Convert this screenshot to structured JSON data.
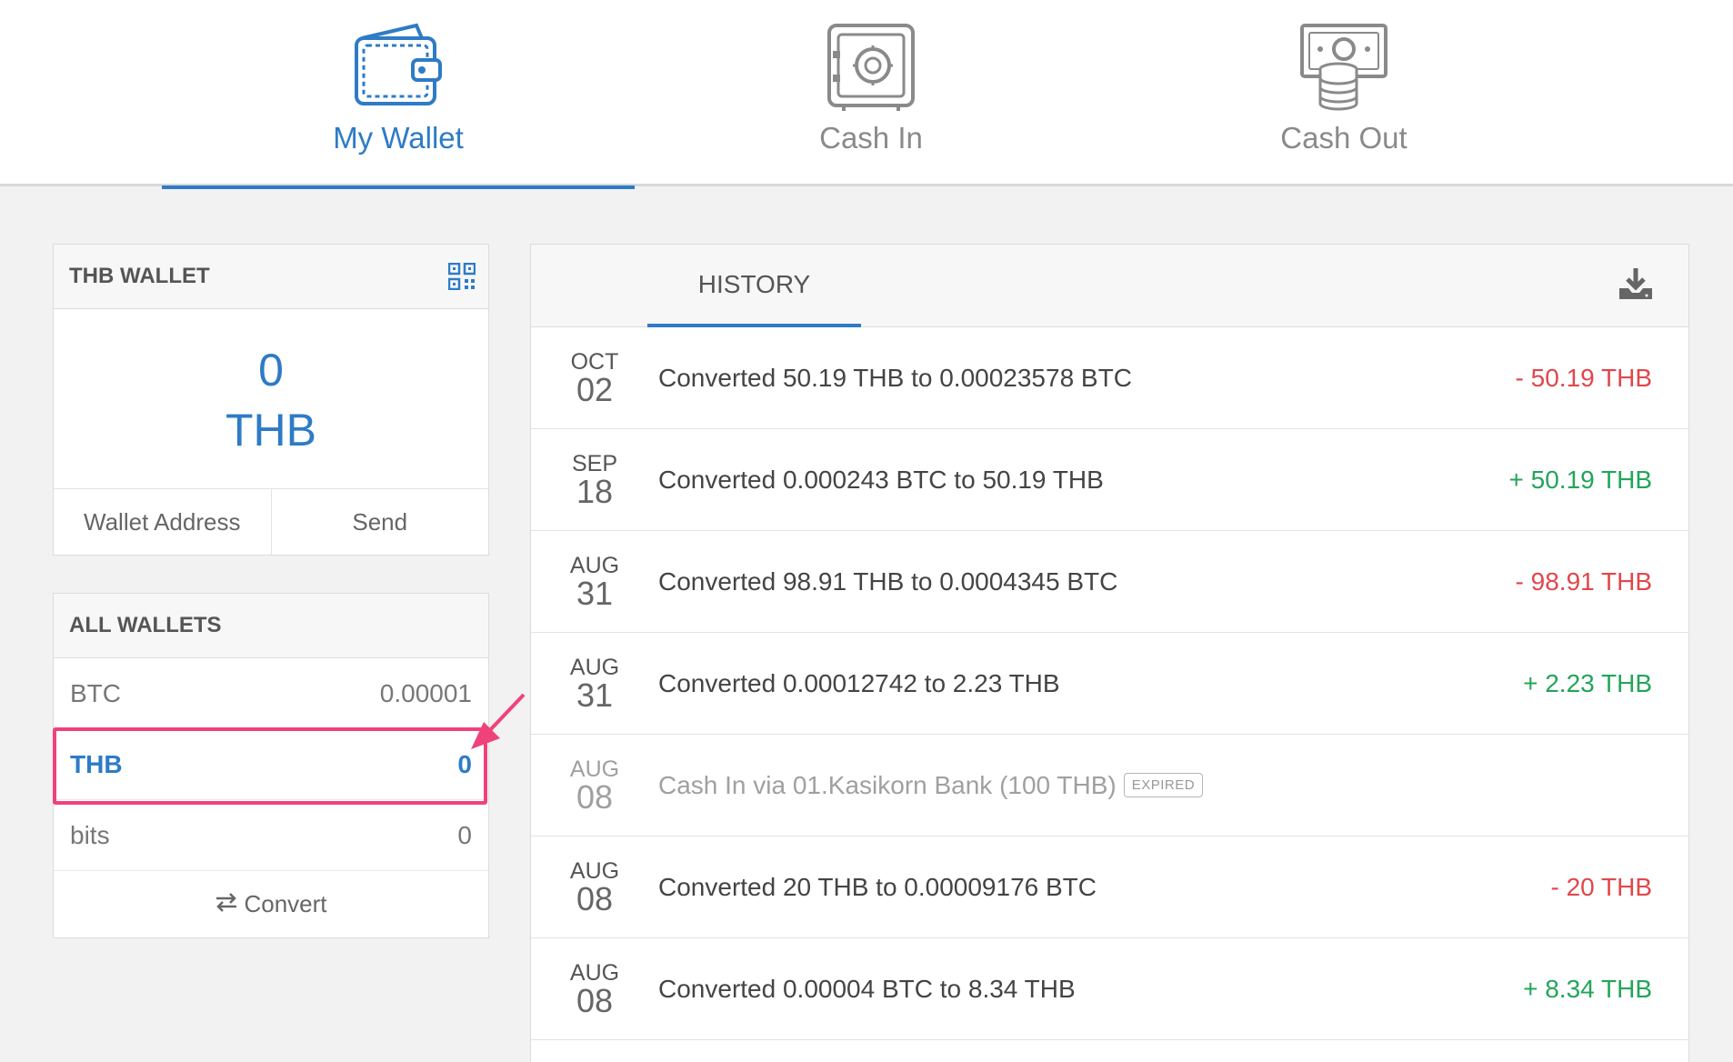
{
  "nav": {
    "tabs": [
      {
        "label": "My Wallet",
        "icon": "wallet-icon",
        "active": true
      },
      {
        "label": "Cash In",
        "icon": "safe-icon",
        "active": false
      },
      {
        "label": "Cash Out",
        "icon": "cash-out-icon",
        "active": false
      }
    ]
  },
  "thb_wallet": {
    "title": "THB WALLET",
    "balance_value": "0",
    "balance_currency": "THB",
    "actions": [
      "Wallet Address",
      "Send"
    ]
  },
  "all_wallets": {
    "title": "ALL WALLETS",
    "rows": [
      {
        "currency": "BTC",
        "amount": "0.00001"
      },
      {
        "currency": "THB",
        "amount": "0"
      },
      {
        "currency": "bits",
        "amount": "0"
      }
    ],
    "convert_label": "Convert"
  },
  "history": {
    "tab_label": "HISTORY",
    "rows": [
      {
        "month": "OCT",
        "day": "02",
        "desc": "Converted 50.19 THB to 0.00023578 BTC",
        "amount": "- 50.19 THB",
        "sign": "neg"
      },
      {
        "month": "SEP",
        "day": "18",
        "desc": "Converted 0.000243 BTC to 50.19 THB",
        "amount": "+ 50.19 THB",
        "sign": "pos"
      },
      {
        "month": "AUG",
        "day": "31",
        "desc": "Converted 98.91 THB to 0.0004345 BTC",
        "amount": "- 98.91 THB",
        "sign": "neg"
      },
      {
        "month": "AUG",
        "day": "31",
        "desc": "Converted 0.00012742 to 2.23 THB",
        "amount": "+ 2.23 THB",
        "sign": "pos"
      },
      {
        "month": "AUG",
        "day": "08",
        "desc": "Cash In via 01.Kasikorn Bank (100 THB)",
        "badge": "EXPIRED",
        "amount": "",
        "sign": "muted"
      },
      {
        "month": "AUG",
        "day": "08",
        "desc": "Converted 20 THB to 0.00009176 BTC",
        "amount": "- 20 THB",
        "sign": "neg"
      },
      {
        "month": "AUG",
        "day": "08",
        "desc": "Converted 0.00004 BTC to 8.34 THB",
        "amount": "+ 8.34 THB",
        "sign": "pos"
      }
    ]
  },
  "colors": {
    "accent": "#2e7bc6",
    "negative": "#e0474c",
    "positive": "#23a55a",
    "highlight": "#f0427a"
  }
}
